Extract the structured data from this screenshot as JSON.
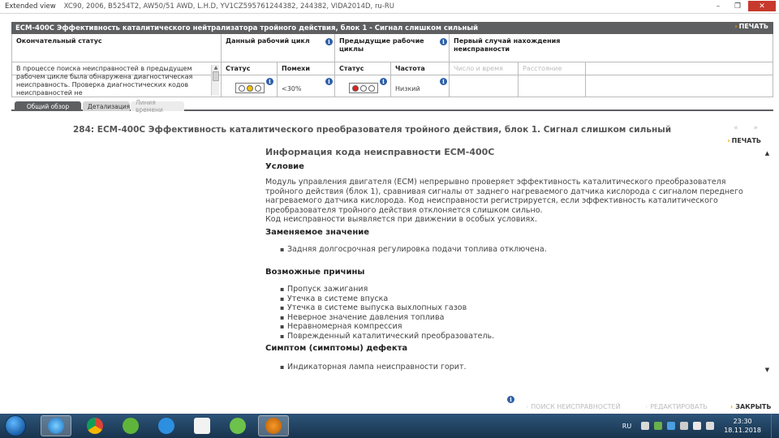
{
  "window": {
    "title": "Extended view",
    "vehicle": "XC90, 2006, B5254T2, AW50/51 AWD, L.H.D, YV1CZ595761244382, 244382, VIDA2014D, ru-RU",
    "controls": [
      "–",
      "❐",
      "✕"
    ]
  },
  "dtc_header": {
    "title": "ECM-400C Эффективность каталитического нейтрализатора тройного действия, блок 1 - Сигнал слишком сильный",
    "print_label": "ПЕЧАТЬ"
  },
  "status_table": {
    "final_status": {
      "header": "Окончательный статус",
      "text": "В процессе поиска неисправностей в предыдущем рабочем цикле была обнаружена диагностическая неисправность. Проверка диагностических кодов неисправностей не"
    },
    "current_cycle": {
      "header": "Данный рабочий цикл",
      "status_label": "Статус",
      "noise_label": "Помехи",
      "noise_value": "<30%",
      "light": "yellow"
    },
    "previous_cycles": {
      "header": "Предыдущие рабочие циклы",
      "status_label": "Статус",
      "frequency_label": "Частота",
      "frequency_value": "Низкий",
      "light": "red"
    },
    "first_occurrence": {
      "header": "Первый случай нахождения неисправности",
      "datetime_label": "Число и время",
      "distance_label": "Расстояние"
    }
  },
  "tabs": [
    {
      "label": "Общий обзор",
      "active": true
    },
    {
      "label": "Детализация",
      "active": false
    },
    {
      "label": "Линия времени",
      "active": false
    }
  ],
  "content": {
    "code_title": "284: ECM-400C Эффективность каталитического преобразователя тройного действия, блок 1. Сигнал слишком сильный",
    "nav_arrows": "«  »",
    "print_label": "ПЕЧАТЬ",
    "doc_title": "Информация кода неисправности ECM-400C",
    "condition_title": "Условие",
    "condition_p1": "Модуль управления двигателя (ECM) непрерывно проверяет эффективность каталитического преобразователя тройного действия (блок 1), сравнивая сигналы от заднего нагреваемого датчика кислорода с сигналом переднего нагреваемого датчика кислорода. Код неисправности регистрируется, если эффективность каталитического преобразователя тройного действия отклоняется слишком сильно.",
    "condition_p2": "Код неисправности выявляется при движении в особых условиях.",
    "substitute_title": "Заменяемое значение",
    "substitute_items": [
      "Задняя долгосрочная регулировка подачи топлива отключена."
    ],
    "causes_title": "Возможные причины",
    "causes_items": [
      "Пропуск зажигания",
      "Утечка в системе впуска",
      "Утечка в системе выпуска выхлопных газов",
      "Неверное значение давления топлива",
      "Неравномерная компрессия",
      "Поврежденный каталитический преобразователь."
    ],
    "symptom_title": "Симптом (симптомы) дефекта",
    "symptom_items": [
      "Индикаторная лампа неисправности горит."
    ]
  },
  "actions": {
    "troubleshoot": "ПОИСК НЕИСПРАВНОСТЕЙ",
    "edit": "РЕДАКТИРОВАТЬ",
    "close": "ЗАКРЫТЬ"
  },
  "taskbar": {
    "lang": "RU",
    "time": "23:30",
    "date": "18.11.2018"
  },
  "colors": {
    "header_bg": "#5d5f61",
    "accent_arrow": "#f0a000",
    "info_icon": "#2c5ea8"
  }
}
